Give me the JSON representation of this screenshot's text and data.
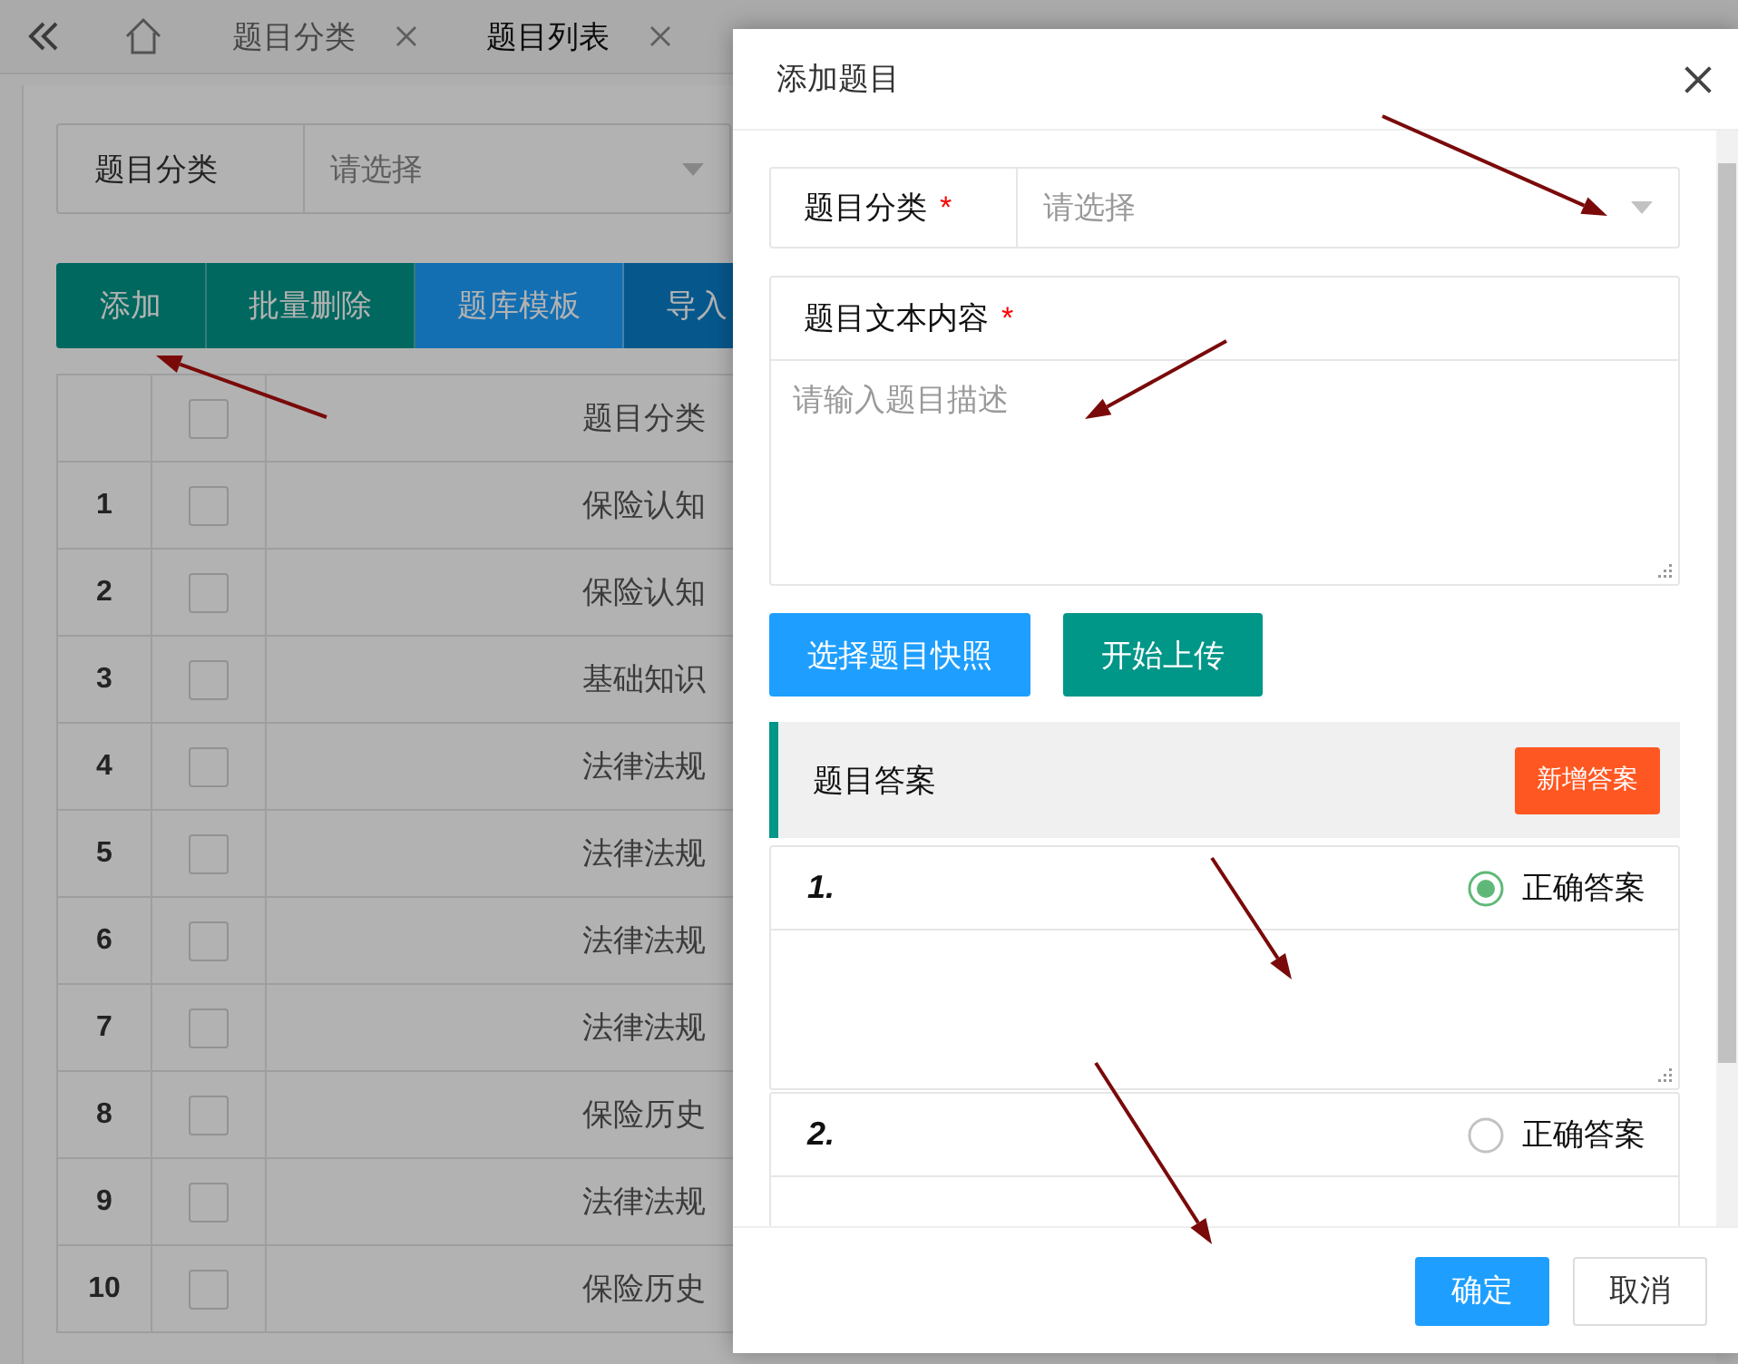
{
  "tab_bar": {
    "tabs": [
      {
        "label": "题目分类",
        "selected": false
      },
      {
        "label": "题目列表",
        "selected": true
      }
    ]
  },
  "filter": {
    "label": "题目分类",
    "placeholder": "请选择"
  },
  "toolbar": [
    {
      "label": "添加",
      "kind": "teal"
    },
    {
      "label": "批量删除",
      "kind": "teal"
    },
    {
      "label": "题库模板",
      "kind": "blue"
    },
    {
      "label": "导入",
      "kind": "navy"
    }
  ],
  "table": {
    "columns": [
      "题目分类"
    ],
    "select_all_checked": false,
    "rows": [
      {
        "index": "1",
        "checked": false,
        "category": "保险认知"
      },
      {
        "index": "2",
        "checked": false,
        "category": "保险认知"
      },
      {
        "index": "3",
        "checked": false,
        "category": "基础知识"
      },
      {
        "index": "4",
        "checked": false,
        "category": "法律法规"
      },
      {
        "index": "5",
        "checked": false,
        "category": "法律法规"
      },
      {
        "index": "6",
        "checked": false,
        "category": "法律法规"
      },
      {
        "index": "7",
        "checked": false,
        "category": "法律法规"
      },
      {
        "index": "8",
        "checked": false,
        "category": "保险历史"
      },
      {
        "index": "9",
        "checked": false,
        "category": "法律法规"
      },
      {
        "index": "10",
        "checked": false,
        "category": "保险历史"
      }
    ]
  },
  "modal": {
    "title": "添加题目",
    "category_field": {
      "label": "题目分类",
      "required_mark": "*",
      "placeholder": "请选择"
    },
    "content_field": {
      "label": "题目文本内容",
      "required_mark": "*",
      "placeholder": "请输入题目描述"
    },
    "upload_buttons": [
      {
        "label": "选择题目快照",
        "kind": "blue"
      },
      {
        "label": "开始上传",
        "kind": "teal"
      }
    ],
    "answers_section": {
      "title": "题目答案",
      "add_button": "新增答案",
      "answers": [
        {
          "number": "1.",
          "correct_label": "正确答案",
          "selected": true
        },
        {
          "number": "2.",
          "correct_label": "正确答案",
          "selected": false
        }
      ]
    },
    "footer_buttons": [
      {
        "label": "确定",
        "kind": "primary"
      },
      {
        "label": "取消",
        "kind": "default"
      }
    ]
  }
}
